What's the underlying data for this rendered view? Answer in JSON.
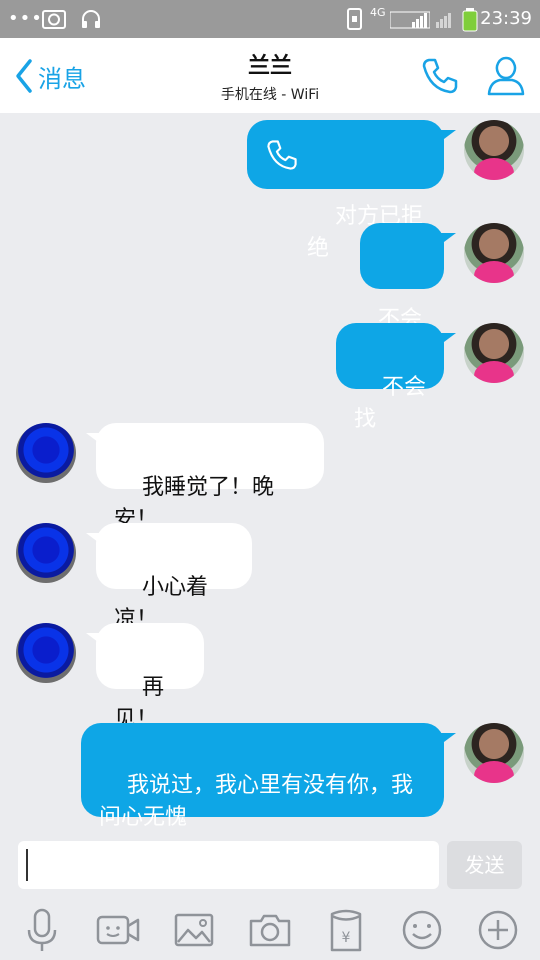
{
  "statusbar": {
    "time": "23:39",
    "network": "4G"
  },
  "header": {
    "back_label": "消息",
    "title": "兰兰",
    "subtitle": "手机在线 - WiFi"
  },
  "messages": [
    {
      "from": "me",
      "text": "对方已拒绝",
      "call_icon": "phone-icon"
    },
    {
      "from": "me",
      "text": "不会"
    },
    {
      "from": "me",
      "text": "不会找"
    },
    {
      "from": "other",
      "text": "我睡觉了！晚安！"
    },
    {
      "from": "other",
      "text": "小心着凉！"
    },
    {
      "from": "other",
      "text": "再见！"
    },
    {
      "from": "me",
      "text": "我说过，我心里有没有你，我\n问心无愧"
    }
  ],
  "composer": {
    "value": "",
    "send_label": "发送"
  },
  "toolbar": [
    "microphone-icon",
    "video-icon",
    "image-icon",
    "camera-icon",
    "red-packet-icon",
    "emoji-icon",
    "plus-icon"
  ],
  "colors": {
    "accent": "#0ea6e6",
    "header_blue": "#19a3e6",
    "background": "#ebecef"
  }
}
